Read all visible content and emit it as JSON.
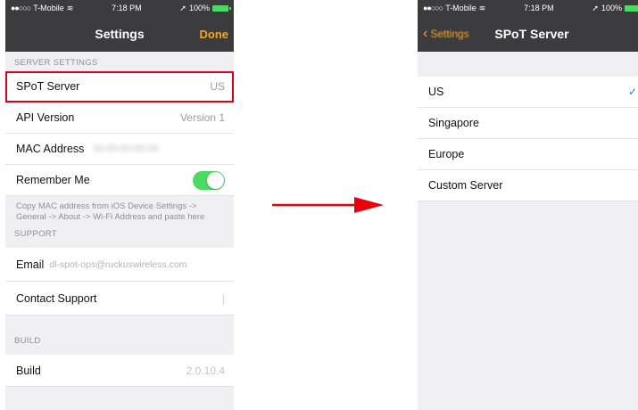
{
  "left": {
    "status": {
      "carrier": "T-Mobile",
      "time": "7:18 PM",
      "battery": "100%"
    },
    "nav": {
      "title": "Settings",
      "done": "Done"
    },
    "server_settings": {
      "header": "SERVER SETTINGS",
      "spot_server_label": "SPoT Server",
      "spot_server_value": "US",
      "api_version_label": "API Version",
      "api_version_value": "Version 1",
      "mac_address_label": "MAC Address",
      "mac_address_value": "00:00:00:00:00",
      "remember_me_label": "Remember Me",
      "remember_me_on": true,
      "footnote": "Copy MAC address from iOS Device Settings -> General -> About -> Wi-Fi Address and paste here"
    },
    "support": {
      "header": "SUPPORT",
      "email_label": "Email",
      "email_value": "dl-spot-ops@ruckuswireless.com",
      "contact_label": "Contact Support"
    },
    "build": {
      "header": "BUILD",
      "build_label": "Build",
      "build_value": "2.0.10.4"
    }
  },
  "right": {
    "status": {
      "carrier": "T-Mobile",
      "time": "7:18 PM",
      "battery": "100%"
    },
    "nav": {
      "back": "Settings",
      "title": "SPoT Server"
    },
    "options": [
      {
        "label": "US",
        "selected": true
      },
      {
        "label": "Singapore",
        "selected": false
      },
      {
        "label": "Europe",
        "selected": false
      },
      {
        "label": "Custom Server",
        "selected": false
      }
    ]
  },
  "colors": {
    "accent": "#f5a623",
    "highlight": "#d9001b",
    "arrow": "#e8000d",
    "toggle": "#4cd964",
    "check": "#1a7fe0"
  },
  "icons": [
    "signal-dots-icon",
    "wifi-icon",
    "battery-icon",
    "location-arrow-icon",
    "toggle-switch",
    "checkmark-icon",
    "chevron-left-icon",
    "arrow-right-icon"
  ]
}
